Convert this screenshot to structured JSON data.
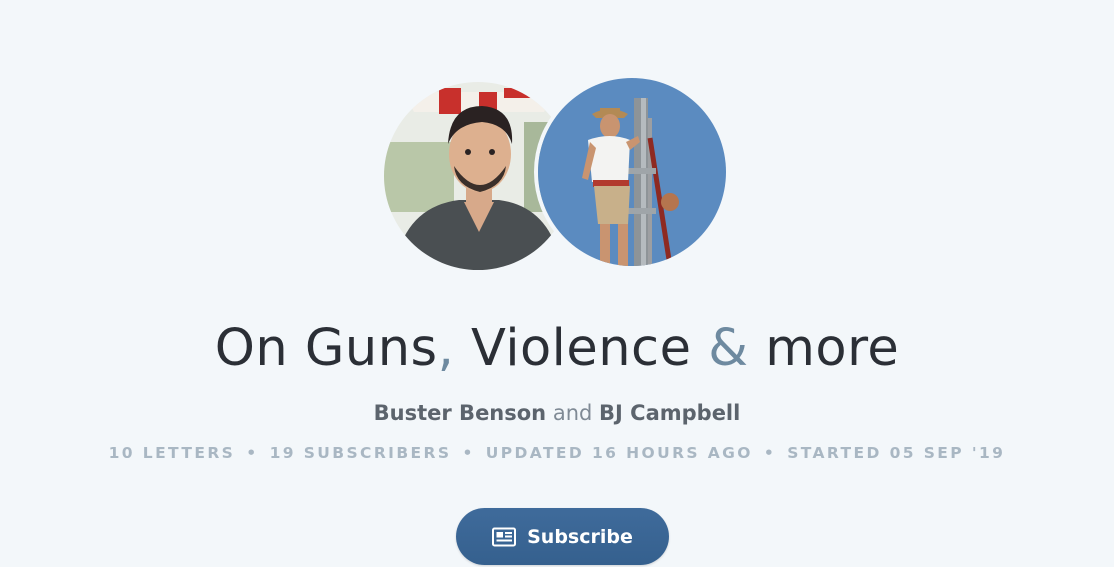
{
  "newsletter": {
    "title_part1": "On Guns",
    "title_comma": ",",
    "title_part2": "Violence",
    "title_amp": "&",
    "title_part3": "more"
  },
  "authors": {
    "author1": "Buster Benson",
    "conjunction": "and",
    "author2": "BJ Campbell"
  },
  "stats": {
    "letters": "10 LETTERS",
    "subscribers": "19 SUBSCRIBERS",
    "updated": "UPDATED 16 HOURS AGO",
    "started": "STARTED 05 SEP '19",
    "separator": "•"
  },
  "subscribe": {
    "label": "Subscribe",
    "icon": "newspaper-icon"
  },
  "colors": {
    "background": "#f3f7fa",
    "title": "#2b2f36",
    "accent": "#6e8aa0",
    "button": "#3a6594",
    "stats": "#a9b7c3"
  }
}
